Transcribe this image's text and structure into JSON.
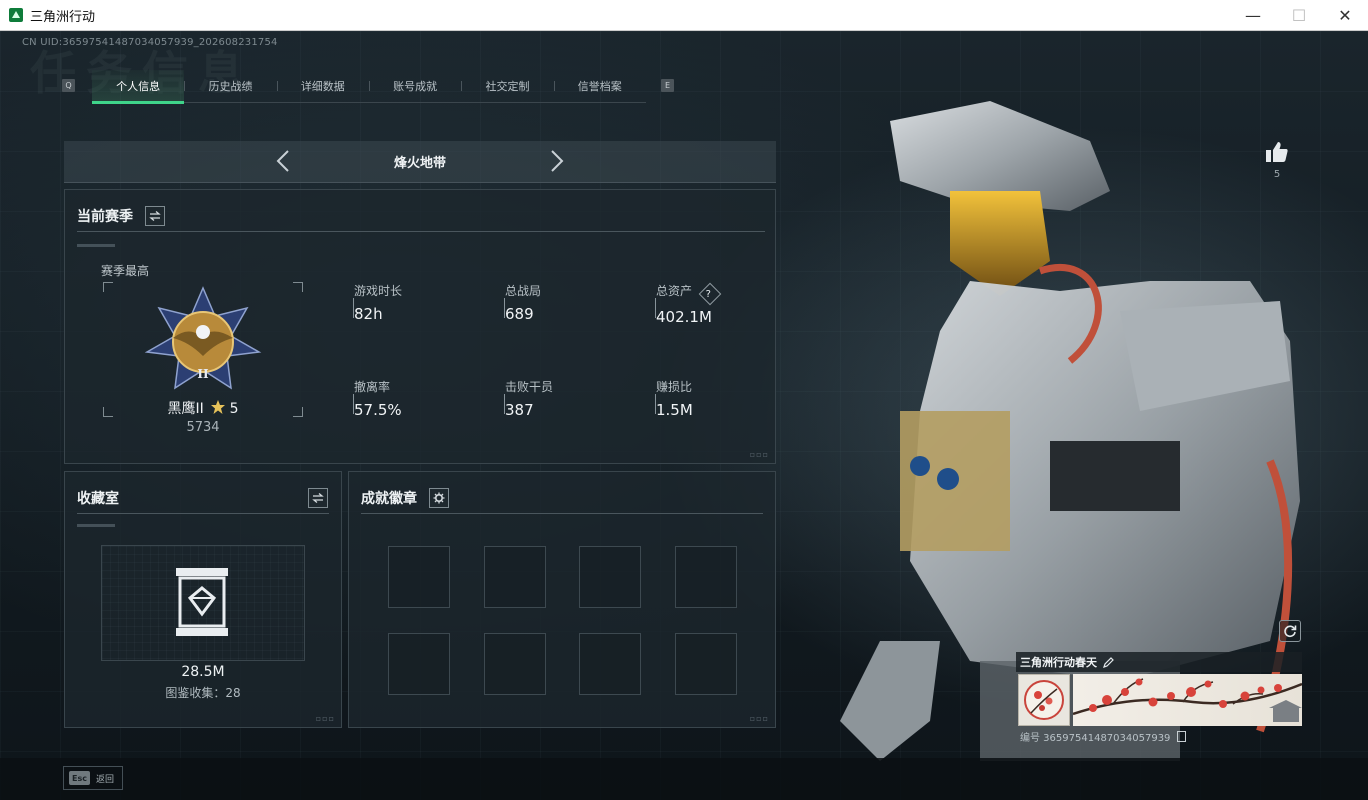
{
  "window": {
    "title": "三角洲行动",
    "minimize": "—",
    "maximize": "☐",
    "close": "✕"
  },
  "uid_text": "CN UID:3659754148703405793​9_202608231754",
  "background_text": "任务信息",
  "tabs": [
    {
      "label": "个人信息",
      "active": true
    },
    {
      "label": "历史战绩",
      "active": false
    },
    {
      "label": "详细数据",
      "active": false
    },
    {
      "label": "账号成就",
      "active": false
    },
    {
      "label": "社交定制",
      "active": false
    },
    {
      "label": "信誉档案",
      "active": false
    }
  ],
  "tab_keys": {
    "left": "Q",
    "right": "E"
  },
  "mode": {
    "title": "烽火地带"
  },
  "season": {
    "title": "当前赛季",
    "best_label": "赛季最高",
    "rank_name": "黑鹰II",
    "rank_stars": "5",
    "rank_score": "5734",
    "stats": [
      {
        "label": "游戏时长",
        "value": "82h"
      },
      {
        "label": "总战局",
        "value": "689"
      },
      {
        "label": "总资产",
        "value": "402.1M",
        "has_help": true
      },
      {
        "label": "撤离率",
        "value": "57.5%"
      },
      {
        "label": "击败干员",
        "value": "387"
      },
      {
        "label": "赚损比",
        "value": "1.5M"
      }
    ]
  },
  "collection": {
    "title": "收藏室",
    "value": "28.5M",
    "sub": "图鉴收集：28"
  },
  "achievements": {
    "title": "成就徽章",
    "slots": 8
  },
  "likes": {
    "count": "5"
  },
  "card": {
    "title": "三角洲行动春天",
    "id_text": "编号 36597541487034057939"
  },
  "footer": {
    "esc_key": "Esc",
    "esc_label": "返回"
  },
  "colors": {
    "accent": "#3fd48a",
    "panel_bg": "#1c262d",
    "text_primary": "#f0f3f5",
    "text_secondary": "#b7c0c5"
  }
}
